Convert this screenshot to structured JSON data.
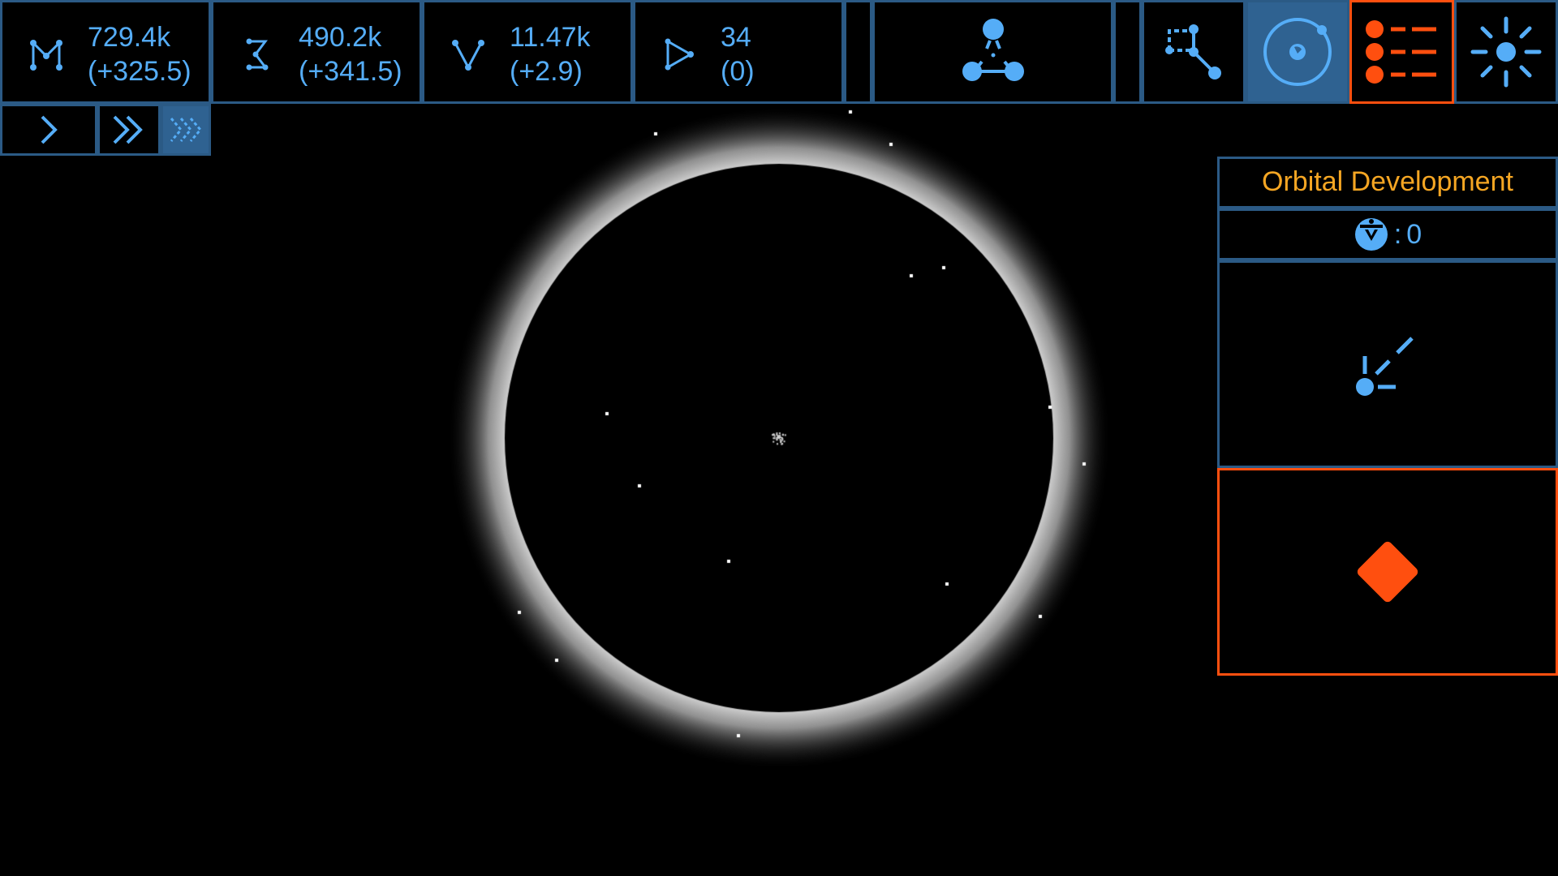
{
  "resources": [
    {
      "id": "matter",
      "icon": "matter-icon",
      "amount": "729.4k",
      "rate": "(+325.5)"
    },
    {
      "id": "energy",
      "icon": "energy-icon",
      "amount": "490.2k",
      "rate": "(+341.5)"
    },
    {
      "id": "vectors",
      "icon": "vector-icon",
      "amount": "11.47k",
      "rate": "(+2.9)"
    },
    {
      "id": "probes",
      "icon": "probe-icon",
      "amount": "34",
      "rate": "(0)"
    }
  ],
  "toolbar": {
    "research_icon": "research-network-icon",
    "path_icon": "path-network-icon",
    "orbit_icon": "orbit-view-icon",
    "list_icon": "task-list-icon",
    "settings_icon": "settings-sun-icon"
  },
  "speed": {
    "options": [
      "speed-1x-icon",
      "speed-2x-icon",
      "speed-3x-icon"
    ],
    "selected": 2
  },
  "panel": {
    "title": "Orbital Development",
    "counter_prefix": ":",
    "counter_value": "0",
    "counter_icon": "station-icon",
    "action_icon": "deploy-icon",
    "alert_icon": "diamond-alert-icon"
  },
  "colors": {
    "accent_blue": "#55adf7",
    "border_blue": "#2b5a85",
    "active_blue": "#2f6291",
    "alert_orange": "#ff4f0f",
    "title_orange": "#f5a623"
  }
}
